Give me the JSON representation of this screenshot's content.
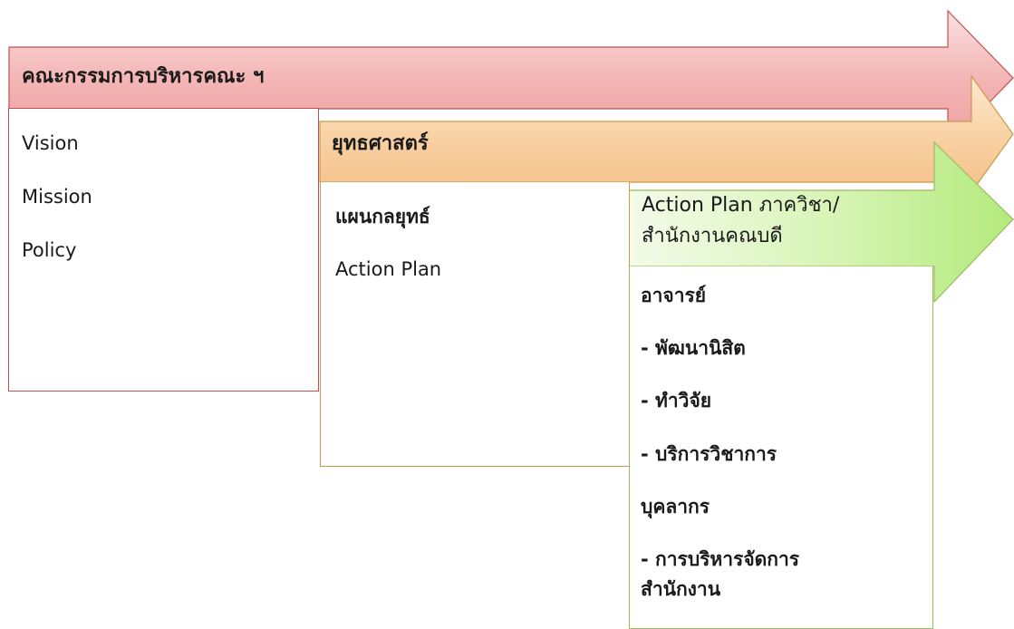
{
  "arrow1": {
    "label": "คณะกรรมการบริหารคณะ ฯ",
    "color": "#f2a7a8",
    "border": "#c0504d"
  },
  "arrow2": {
    "label": "ยุทธศาสตร์",
    "color": "#f8cf9c",
    "border": "#c89a4a"
  },
  "arrow3": {
    "label_line1": "Action Plan ภาควิชา/",
    "label_line2": "สำนักงานคณบดี",
    "color": "#c3ec98",
    "border": "#9bbb59"
  },
  "box1": {
    "items": [
      "Vision",
      "Mission",
      "Policy"
    ]
  },
  "box2": {
    "items": [
      "แผนกลยุทธ์",
      "Action Plan"
    ]
  },
  "box3": {
    "items": [
      "อาจารย์",
      "- พัฒนานิสิต",
      "- ทำวิจัย",
      "- บริการวิชาการ",
      "บุคลากร",
      "- การบริหารจัดการ",
      "สำนักงาน"
    ]
  }
}
